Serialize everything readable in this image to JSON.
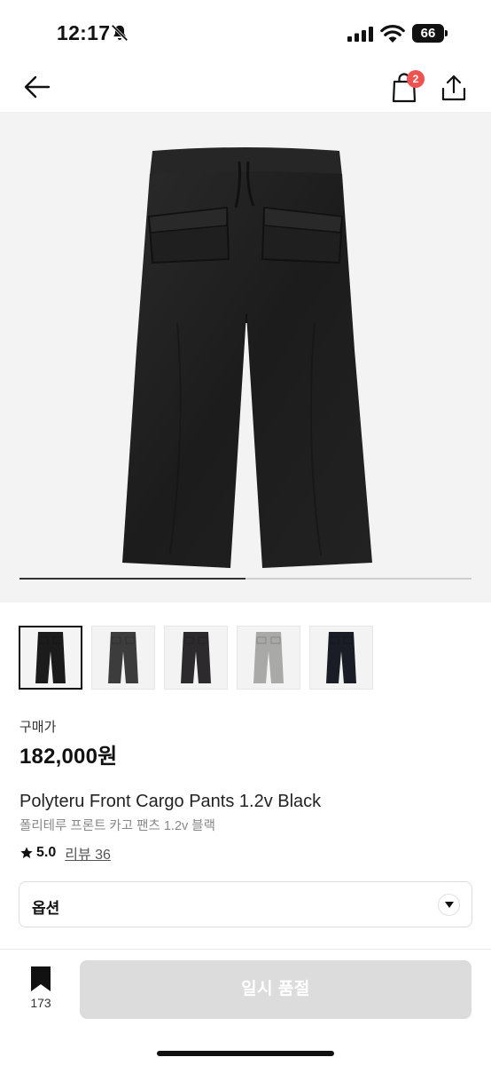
{
  "status_bar": {
    "time": "12:17",
    "battery": "66"
  },
  "nav": {
    "cart_count": "2",
    "icons": [
      "back-arrow-icon",
      "shopping-bag-icon",
      "share-icon"
    ]
  },
  "gallery": {
    "progress_fraction": 0.5,
    "thumbnail_colors": [
      "#1b1b1b",
      "#3c3c3c",
      "#2c2a2c",
      "#a9a9a7",
      "#1b1d26"
    ],
    "selected_index": 0
  },
  "product": {
    "price_label": "구매가",
    "price": "182,000원",
    "title_en": "Polyteru Front Cargo Pants 1.2v Black",
    "title_ko": "폴리테루 프론트 카고 팬츠 1.2v 블랙",
    "rating": "5.0",
    "reviews": "리뷰 36"
  },
  "option": {
    "label": "옵션"
  },
  "bottom_bar": {
    "bookmark_count": "173",
    "cta_label": "일시 품절"
  }
}
